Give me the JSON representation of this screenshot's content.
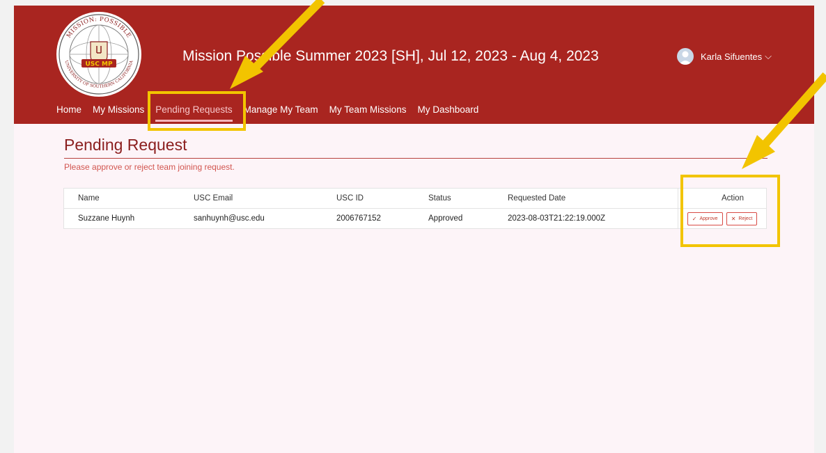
{
  "header": {
    "logo": {
      "text_top": "MISSION: POSSIBLE",
      "text_center": "USC MP",
      "text_bottom": "UNIVERSITY OF SOUTHERN CALIFORNIA"
    },
    "title": "Mission Possible Summer 2023 [SH], Jul 12, 2023 - Aug 4, 2023",
    "user_name": "Karla Sifuentes",
    "nav": [
      "Home",
      "My Missions",
      "Pending Requests",
      "Manage My Team",
      "My Team Missions",
      "My Dashboard"
    ],
    "active_nav": "Pending Requests"
  },
  "page": {
    "heading": "Pending Request",
    "subtitle": "Please approve or reject team joining request."
  },
  "table": {
    "columns": [
      "Name",
      "USC Email",
      "USC ID",
      "Status",
      "Requested Date",
      "Action"
    ],
    "rows": [
      {
        "name": "Suzzane Huynh",
        "email": "sanhuynh@usc.edu",
        "usc_id": "2006767152",
        "status": "Approved",
        "requested_date": "2023-08-03T21:22:19.000Z"
      }
    ],
    "approve_label": "Approve",
    "reject_label": "Reject"
  },
  "colors": {
    "brand_red": "#a92520",
    "highlight_yellow": "#f2c400",
    "page_bg": "#fdf4f8"
  }
}
